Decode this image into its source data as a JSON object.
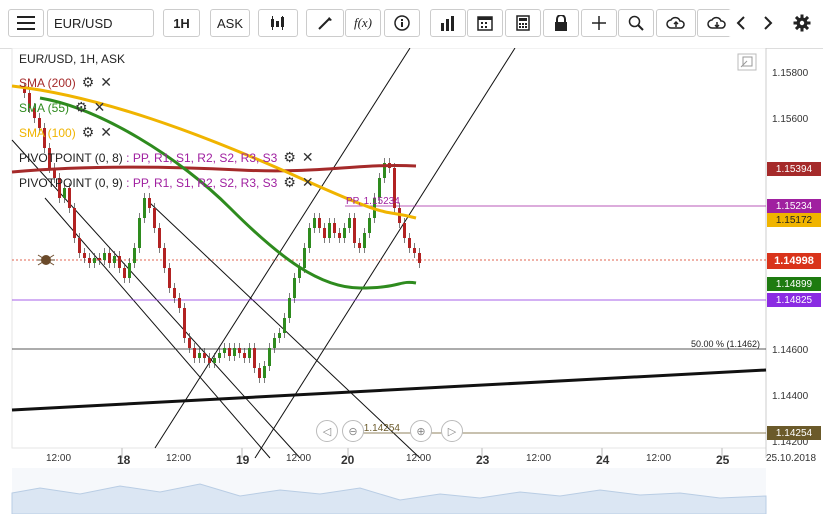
{
  "toolbar": {
    "symbol": "EUR/USD",
    "timeframe": "1H",
    "price_type": "ASK",
    "f_label": "f(x)"
  },
  "chart": {
    "header": "EUR/USD, 1H, ASK",
    "indicators": [
      {
        "label": "SMA (200)",
        "color": "#a52a2a"
      },
      {
        "label": "SMA (55)",
        "color": "#2e8b1e"
      },
      {
        "label": "SMA (100)",
        "color": "#f0b400"
      }
    ],
    "pivots": [
      {
        "prefix": "PIVOTPOINT (0, 8)",
        "items": ": PP, R1, S1, R2, S2, R3, S3"
      },
      {
        "prefix": "PIVOTPOINT (0, 9)",
        "items": ": PP, R1, S1, R2, S2, R3, S3"
      }
    ],
    "price_axis": [
      "1.15800",
      "1.15600",
      "1.14600",
      "1.14400",
      "1.14200"
    ],
    "price_labels": [
      {
        "value": "1.15394",
        "color": "#a52a2a"
      },
      {
        "value": "1.15234",
        "color": "#a020a0"
      },
      {
        "value": "1.15172",
        "color": "#f0b400"
      },
      {
        "value": "1.14998",
        "color": "#d9331a"
      },
      {
        "value": "1.14899",
        "color": "#1e7b10"
      },
      {
        "value": "1.14825",
        "color": "#8a2be2"
      },
      {
        "value": "1.14254",
        "color": "#6b5a2a"
      }
    ],
    "time_axis": [
      "12:00",
      "18",
      "12:00",
      "19",
      "12:00",
      "20",
      "12:00",
      "23",
      "12:00",
      "24",
      "12:00",
      "25",
      "25.10.2018"
    ],
    "annotations": {
      "pp": "PP, 1.15234",
      "fib": "50.00 % (1.1462)",
      "s": "S3, 1.14254"
    }
  },
  "colors": {
    "accent": "#1a1a1a",
    "bull": "#2e8b1e",
    "bear": "#b22222",
    "sma200": "#a52a2a",
    "sma55": "#2e8b1e",
    "sma100": "#f0b400",
    "pivot": "#a020a0"
  }
}
